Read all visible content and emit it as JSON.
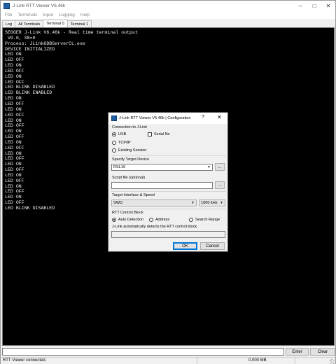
{
  "window": {
    "title": "J-Link RTT Viewer V6.46k",
    "controls": [
      "–",
      "□",
      "✕"
    ]
  },
  "menu": [
    "File",
    "Terminals",
    "Input",
    "Logging",
    "Help"
  ],
  "tabs": [
    {
      "label": "Log",
      "active": false
    },
    {
      "label": "All Terminals",
      "active": false
    },
    {
      "label": "Terminal 0",
      "active": true
    },
    {
      "label": "Terminal 1",
      "active": false
    }
  ],
  "terminal": {
    "lines": [
      "SEGGER J-Link V6.46k - Real time terminal output",
      " V0.0, SN=0",
      "Process: JLinkGDBServerCL.exe",
      "DEVICE INITIALIZED",
      "LED ON",
      "LED OFF",
      "LED ON",
      "LED OFF",
      "LED ON",
      "LED OFF",
      "LED BLINK DISABLED",
      "LED BLINK ENABLED",
      "LED ON",
      "LED OFF",
      "LED ON",
      "LED OFF",
      "LED ON",
      "LED OFF",
      "LED ON",
      "LED OFF",
      "LED ON",
      "LED OFF",
      "LED ON",
      "LED OFF",
      "LED ON",
      "LED OFF",
      "LED ON",
      "LED OFF",
      "LED ON",
      "LED OFF",
      "LED ON",
      "LED OFF",
      "LED BLINK DISABLED"
    ]
  },
  "input_bar": {
    "value": "",
    "enter_label": "Enter",
    "clear_label": "Clear"
  },
  "status": {
    "message": "RTT Viewer connected.",
    "data": "0.000 MB"
  },
  "dialog": {
    "title": "J-Link RTT Viewer V6.46k | Configuration",
    "help": "?",
    "close": "✕",
    "connection": {
      "label": "Connection to J-Link",
      "usb": "USB",
      "serial_no": "Serial No",
      "tcpip": "TCP/IP",
      "existing_session": "Existing Session",
      "selected": "USB"
    },
    "target_device": {
      "label": "Specify Target Device",
      "value": "RSL10",
      "browse": "..."
    },
    "script_file": {
      "label": "Script file (optional)",
      "value": "",
      "browse": "..."
    },
    "interface": {
      "label": "Target Interface & Speed",
      "value": "SWD",
      "speed": "1000 kHz"
    },
    "rtt_control": {
      "label": "RTT Control Block",
      "auto": "Auto Detection",
      "address": "Address",
      "search": "Search Range",
      "selected": "Auto Detection",
      "hint": "J-Link automatically detects the RTT control block.",
      "value": ""
    },
    "ok_label": "OK",
    "cancel_label": "Cancel"
  }
}
